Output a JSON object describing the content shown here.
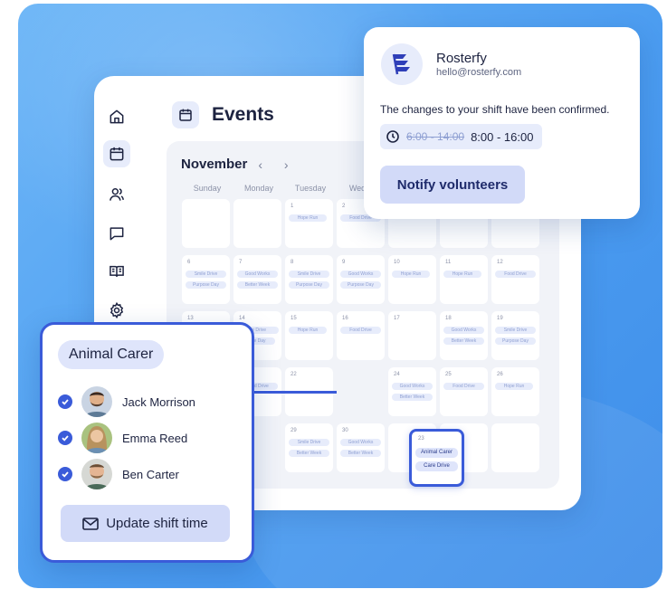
{
  "colors": {
    "accent": "#3a5bd9",
    "background": "#4b9cf0",
    "chip": "#e7ecfb",
    "button": "#d2daf8",
    "text": "#1d2340"
  },
  "sidebar": {
    "items": [
      {
        "icon": "home-icon"
      },
      {
        "icon": "calendar-icon"
      },
      {
        "icon": "users-icon"
      },
      {
        "icon": "message-icon"
      },
      {
        "icon": "book-icon"
      },
      {
        "icon": "gear-icon"
      }
    ]
  },
  "header": {
    "title": "Events",
    "icon": "calendar-icon"
  },
  "calendar": {
    "month": "November",
    "weekdays": [
      "Sunday",
      "Monday",
      "Tuesday",
      "Wedne"
    ],
    "days": [
      {
        "n": "1",
        "events": [
          "Hope Run"
        ]
      },
      {
        "n": "2",
        "events": [
          "Food Drive"
        ]
      },
      {
        "n": "6",
        "events": [
          "Smile Drive",
          "Purpose Day"
        ]
      },
      {
        "n": "7",
        "events": [
          "Good Works",
          "Better Week"
        ]
      },
      {
        "n": "8",
        "events": [
          "Smile Drive",
          "Purpose Day"
        ]
      },
      {
        "n": "9",
        "events": [
          "Good Works",
          "Purpose Day"
        ]
      },
      {
        "n": "10",
        "events": [
          "Hope Run"
        ]
      },
      {
        "n": "11",
        "events": [
          "Hope Run"
        ]
      },
      {
        "n": "12",
        "events": [
          "Food Drive"
        ]
      },
      {
        "n": "13",
        "events": []
      },
      {
        "n": "14",
        "events": [
          "ile Drive",
          "pose Day"
        ]
      },
      {
        "n": "15",
        "events": [
          "Hope Run"
        ]
      },
      {
        "n": "16",
        "events": [
          "Food Drive"
        ]
      },
      {
        "n": "17",
        "events": []
      },
      {
        "n": "18",
        "events": [
          "Good Works",
          "Better Week"
        ]
      },
      {
        "n": "19",
        "events": [
          "Smile Drive",
          "Purpose Day"
        ]
      },
      {
        "n": "",
        "events": [
          "Food Drive"
        ]
      },
      {
        "n": "22",
        "events": []
      },
      {
        "n": "24",
        "events": [
          "Good Works",
          "Better Week"
        ]
      },
      {
        "n": "25",
        "events": [
          "Food Drive"
        ]
      },
      {
        "n": "26",
        "events": [
          "Hope Run"
        ]
      },
      {
        "n": "29",
        "events": [
          "Smile Drive",
          "Better Week"
        ]
      },
      {
        "n": "30",
        "events": [
          "Good Works",
          "Better Week"
        ]
      }
    ],
    "highlighted": {
      "n": "23",
      "events": [
        "Animal Carer",
        "Care Drive"
      ]
    }
  },
  "notification": {
    "brand": "Rosterfy",
    "email": "hello@rosterfy.com",
    "message": "The changes to your shift have been confirmed.",
    "old_time": "6:00 - 14:00",
    "new_time": "8:00 - 16:00",
    "button": "Notify volunteers"
  },
  "shift": {
    "role": "Animal Carer",
    "people": [
      {
        "name": "Jack Morrison"
      },
      {
        "name": "Emma Reed"
      },
      {
        "name": "Ben Carter"
      }
    ],
    "button": "Update shift time"
  }
}
